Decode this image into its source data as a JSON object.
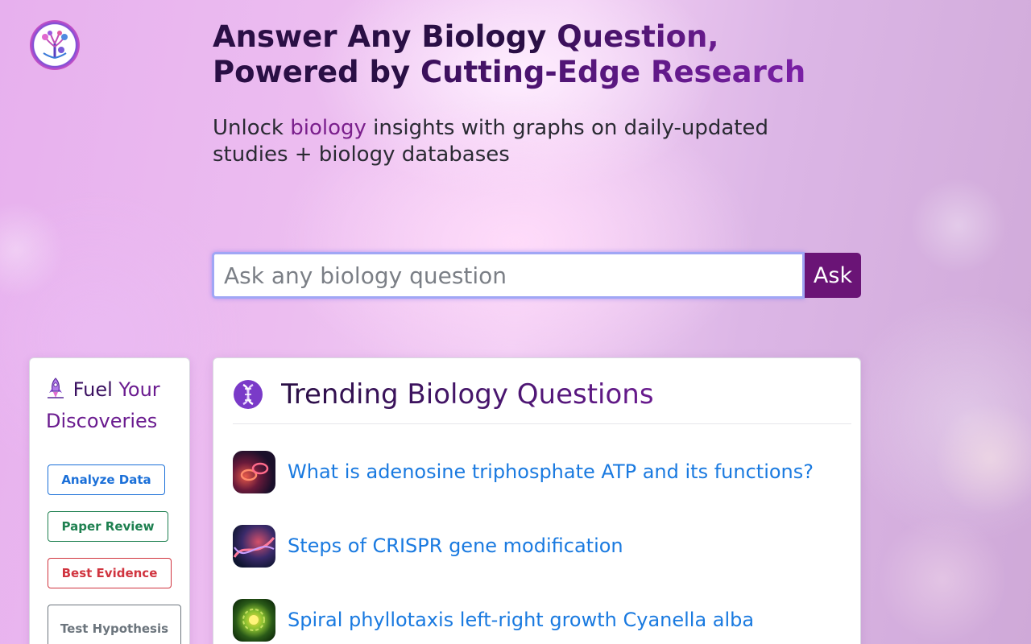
{
  "hero": {
    "title_line1_a": "Answer Any Biology ",
    "title_line1_b": "Question,",
    "title_line2_a": "Powered by ",
    "title_line2_b": "Cutting-Edge Research",
    "subtitle_pre": "Unlock ",
    "subtitle_accent": "biology",
    "subtitle_post": " insights with graphs on daily-updated studies + biology databases"
  },
  "search": {
    "placeholder": "Ask any biology question",
    "value": "",
    "button_label": "Ask"
  },
  "sidebar": {
    "icon": "rocket-icon",
    "title_a": "Fuel ",
    "title_b": "Your Discoveries",
    "buttons": [
      {
        "label": "Analyze Data",
        "color": "#1a6fd8"
      },
      {
        "label": "Paper Review",
        "color": "#1e8050"
      },
      {
        "label": "Best Evidence",
        "color": "#d0343f"
      },
      {
        "label": "Test Hypothesis",
        "color": "#6c757d"
      }
    ]
  },
  "trending": {
    "icon": "dna-icon",
    "title": "Trending Biology Questions",
    "questions": [
      {
        "text": "What is adenosine triphosphate ATP and its functions?",
        "thumb": "atp-molecule-thumbnail"
      },
      {
        "text": "Steps of CRISPR gene modification",
        "thumb": "dna-helix-thumbnail"
      },
      {
        "text": "Spiral phyllotaxis left-right growth Cyanella alba",
        "thumb": "plant-spiral-thumbnail"
      }
    ]
  },
  "colors": {
    "accent": "#6a1476",
    "link": "#1a7ae0",
    "title": "#2a0f45"
  }
}
